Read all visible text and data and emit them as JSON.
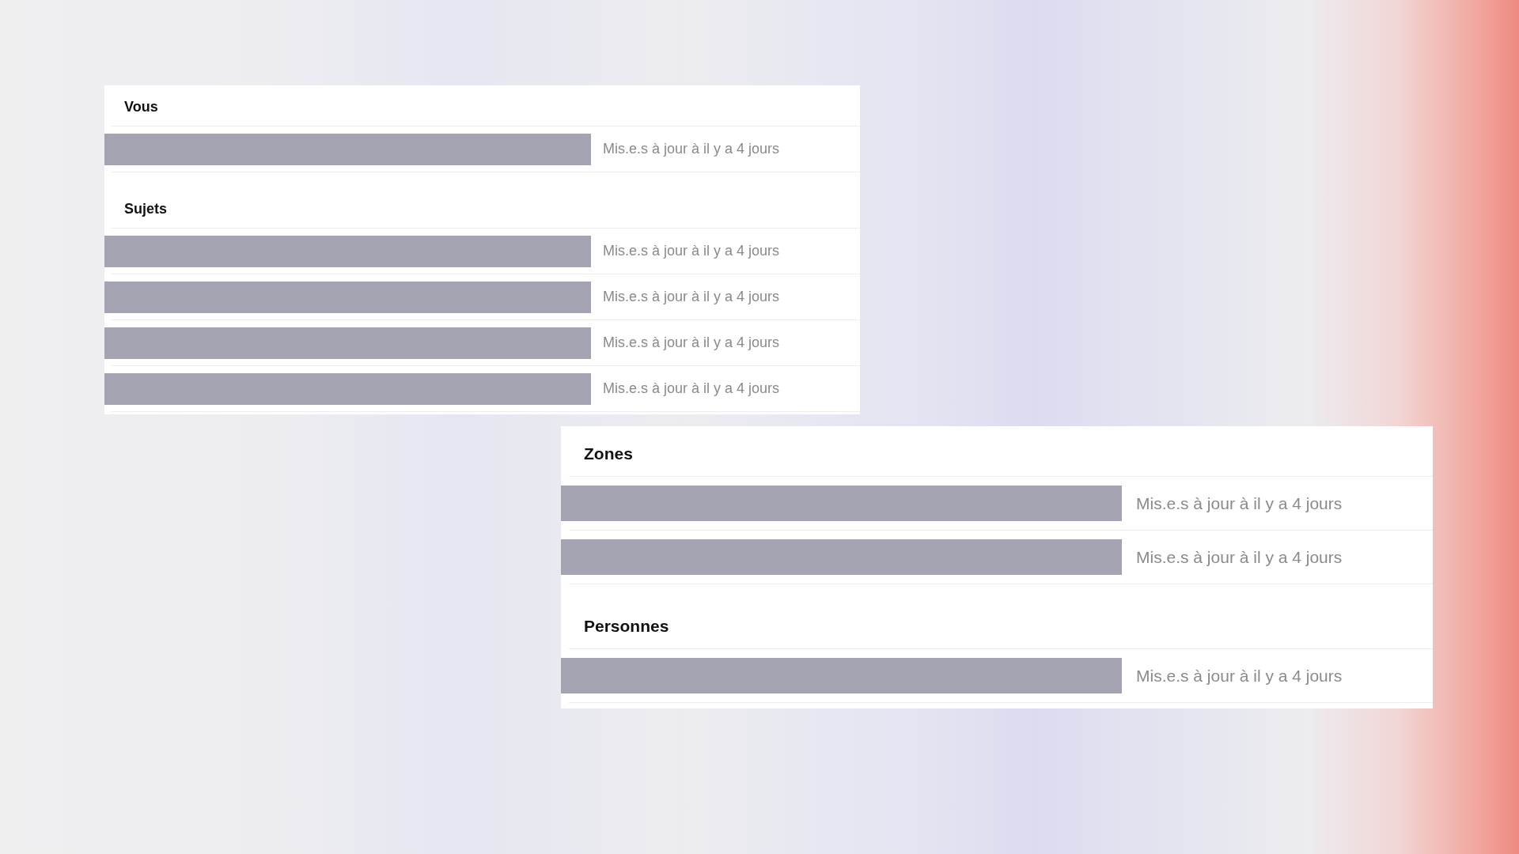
{
  "panels": [
    {
      "sections": [
        {
          "title": "Vous",
          "rows": [
            {
              "updated": "Mis.e.s à jour à il y a 4 jours"
            }
          ]
        },
        {
          "title": "Sujets",
          "rows": [
            {
              "updated": "Mis.e.s à jour à il y a 4 jours"
            },
            {
              "updated": "Mis.e.s à jour à il y a 4 jours"
            },
            {
              "updated": "Mis.e.s à jour à il y a 4 jours"
            },
            {
              "updated": "Mis.e.s à jour à il y a 4 jours"
            }
          ]
        }
      ]
    },
    {
      "sections": [
        {
          "title": "Zones",
          "rows": [
            {
              "updated": "Mis.e.s à jour à il y a 4 jours"
            },
            {
              "updated": "Mis.e.s à jour à il y a 4 jours"
            }
          ]
        },
        {
          "title": "Personnes",
          "rows": [
            {
              "updated": "Mis.e.s à jour à il y a 4 jours"
            }
          ]
        }
      ]
    }
  ]
}
